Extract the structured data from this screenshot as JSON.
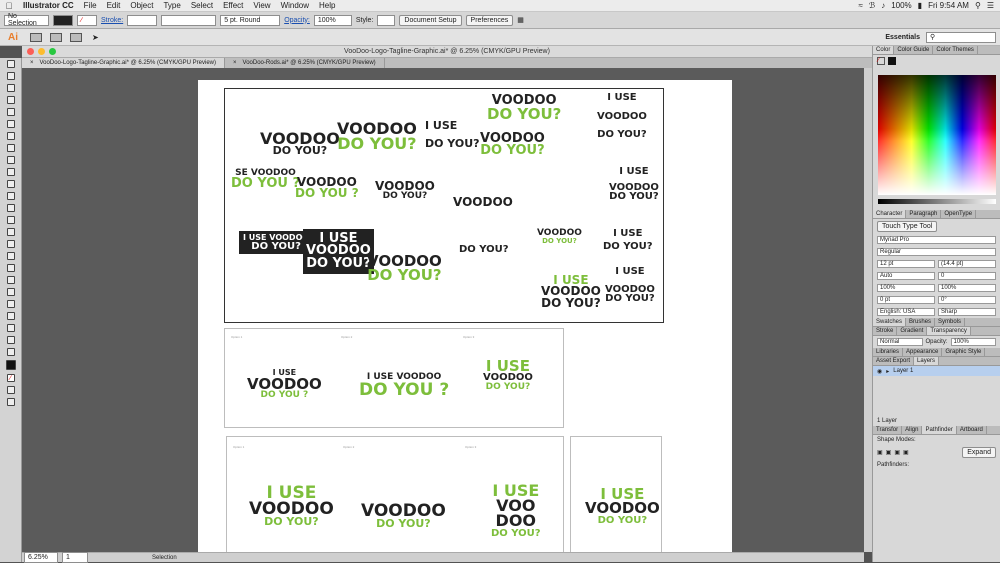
{
  "menubar": {
    "app_name": "Illustrator CC",
    "items": [
      "File",
      "Edit",
      "Object",
      "Type",
      "Select",
      "Effect",
      "View",
      "Window",
      "Help"
    ],
    "battery": "100%",
    "clock": "Fri 9:54 AM"
  },
  "control_bar": {
    "selection": "No Selection",
    "stroke_label": "Stroke:",
    "brush": "5 pt. Round",
    "opacity_label": "Opacity:",
    "opacity_value": "100%",
    "style_label": "Style:",
    "doc_setup": "Document Setup",
    "preferences": "Preferences"
  },
  "app_bar": {
    "logo": "Ai",
    "workspace": "Essentials"
  },
  "document": {
    "title": "VooDoo-Logo-Tagline-Graphic.ai* @ 6.25% (CMYK/GPU Preview)",
    "tabs": [
      "VooDoo-Logo-Tagline-Graphic.ai* @ 6.25% (CMYK/GPU Preview)",
      "VooDoo-Rods.ai* @ 6.25% (CMYK/GPU Preview)"
    ]
  },
  "artwork": {
    "t1": [
      "VOODOO",
      "DO YOU?"
    ],
    "t2": [
      "I USE",
      "VOODOO",
      "DO YOU?"
    ],
    "t3": [
      "I USE",
      "DO YOU?"
    ],
    "t4": [
      "SE VOODOO",
      "DO YOU ?"
    ],
    "t5": [
      "VOODOO",
      "DO YOU ?"
    ],
    "t6": [
      "VOODOO",
      "DO YOU?"
    ],
    "t7": [
      "VOODOO",
      "DO YOU?"
    ],
    "t8": [
      "I USE",
      "VOODOO",
      "DO YOU?"
    ],
    "t9": [
      "I USE VOODOO",
      "DO YOU?"
    ],
    "t10": [
      "I USE",
      "VOODOO",
      "DO YOU?"
    ],
    "t11": [
      "VOODOO",
      "DO YOU?"
    ],
    "t12": [
      "DO YOU?"
    ],
    "t13": [
      "DO YOU?"
    ],
    "t14": [
      "I USE",
      "DO YOU?"
    ],
    "t15": [
      "I USE",
      "VOODOO",
      "DO YOU?"
    ],
    "t16": [
      "I USE",
      "VOODOO",
      "DO YOU?"
    ],
    "row2": [
      [
        "I USE",
        "VOODOO",
        "DO YOU ?"
      ],
      [
        "I USE VOODOO",
        "DO YOU ?"
      ],
      [
        "I USE",
        "VOODOO",
        "DO YOU?"
      ]
    ],
    "row3": [
      [
        "I USE",
        "VOODOO",
        "DO YOU?"
      ],
      [
        "VOODOO",
        "DO YOU?"
      ],
      [
        "I USE",
        "VOO",
        "DOO",
        "DO YOU?"
      ],
      [
        "I USE",
        "VOODOO",
        "DO YOU?"
      ]
    ],
    "small_labels": [
      "Option 1",
      "Option 2",
      "Option 3"
    ]
  },
  "status": {
    "zoom": "6.25%",
    "artboard": "1",
    "tool": "Selection"
  },
  "panels": {
    "color_tabs": [
      "Color",
      "Color Guide",
      "Color Themes"
    ],
    "char_tabs": [
      "Character",
      "Paragraph",
      "OpenType"
    ],
    "touch_type": "Touch Type Tool",
    "font_family": "Myriad Pro",
    "font_style": "Regular",
    "size": "12 pt",
    "leading": "(14.4 pt)",
    "kerning": "Auto",
    "tracking": "0",
    "hscale": "100%",
    "vscale": "100%",
    "baseline": "0 pt",
    "rotate": "0°",
    "language": "English: USA",
    "aa": "Sharp",
    "swatch_tabs": [
      "Swatches",
      "Brushes",
      "Symbols"
    ],
    "stroke_tabs": [
      "Stroke",
      "Gradient",
      "Transparency"
    ],
    "blend": "Normal",
    "opacity_label": "Opacity:",
    "opacity": "100%",
    "lib_tabs": [
      "Libraries",
      "Appearance",
      "Graphic Style"
    ],
    "layer_tabs": [
      "Asset Export",
      "Layers"
    ],
    "layer_name": "Layer 1",
    "layer_count": "1 Layer",
    "path_tabs": [
      "Transfor",
      "Align",
      "Pathfinder",
      "Artboard"
    ],
    "shape_modes": "Shape Modes:",
    "expand": "Expand",
    "pathfinders": "Pathfinders:"
  },
  "colors": {
    "green": "#7dbe3b",
    "accent": "#e87e2c"
  }
}
